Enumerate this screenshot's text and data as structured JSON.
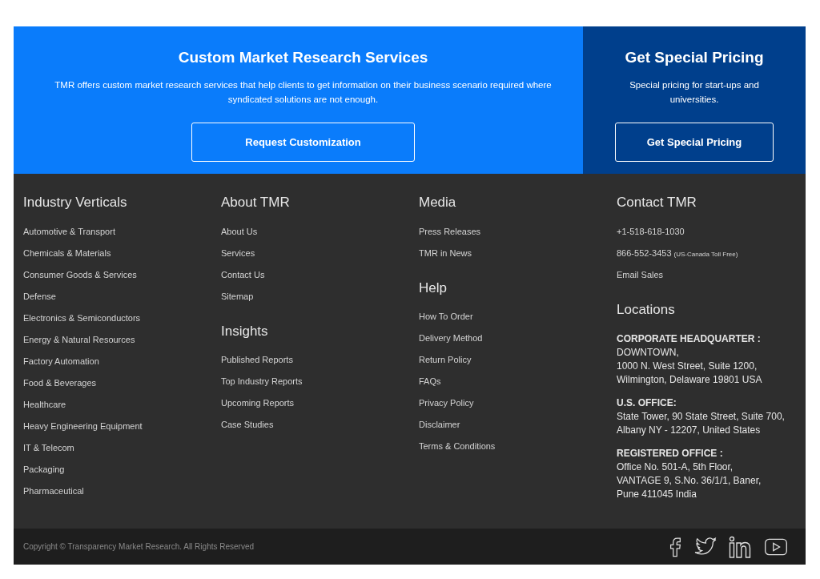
{
  "cta": [
    {
      "kind": "primary",
      "title": "Custom Market Research Services",
      "text": "TMR offers custom market research services that help clients to get information on their business scenario required where syndicated solutions are not enough.",
      "button": "Request Customization"
    },
    {
      "kind": "secondary",
      "title": "Get Special Pricing",
      "text": "Special pricing for start-ups and universities.",
      "button": "Get Special Pricing"
    }
  ],
  "columns": [
    {
      "kind": "links",
      "sections": [
        {
          "heading": "Industry Verticals",
          "links": [
            "Automotive & Transport",
            "Chemicals & Materials",
            "Consumer Goods & Services",
            "Defense",
            "Electronics & Semiconductors",
            "Energy & Natural Resources",
            "Factory Automation",
            "Food & Beverages",
            "Healthcare",
            "Heavy Engineering Equipment",
            "IT & Telecom",
            "Packaging",
            "Pharmaceutical"
          ]
        }
      ]
    },
    {
      "kind": "links",
      "sections": [
        {
          "heading": "About TMR",
          "links": [
            "About Us",
            "Services",
            "Contact Us",
            "Sitemap"
          ]
        },
        {
          "heading": "Insights",
          "links": [
            "Published Reports",
            "Top Industry Reports",
            "Upcoming Reports",
            "Case Studies"
          ]
        }
      ]
    },
    {
      "kind": "links",
      "sections": [
        {
          "heading": "Media",
          "links": [
            "Press Releases",
            "TMR in News"
          ]
        },
        {
          "heading": "Help",
          "links": [
            "How To Order",
            "Delivery Method",
            "Return Policy",
            "FAQs",
            "Privacy Policy",
            "Disclaimer",
            "Terms & Conditions"
          ]
        }
      ]
    },
    {
      "kind": "contact",
      "heading": "Contact TMR",
      "contacts": [
        {
          "text": "+1-518-618-1030"
        },
        {
          "text": "866-552-3453",
          "note": "(US-Canada Toll Free)"
        },
        {
          "text": "Email Sales"
        }
      ],
      "locations_heading": "Locations",
      "offices": [
        {
          "title": "CORPORATE HEADQUARTER :",
          "lines": [
            "DOWNTOWN,",
            "1000 N. West Street, Suite 1200,",
            "Wilmington, Delaware 19801 USA"
          ]
        },
        {
          "title": "U.S. OFFICE:",
          "lines": [
            "State Tower, 90 State Street, Suite 700,",
            "Albany NY - 12207, United States"
          ]
        },
        {
          "title": "REGISTERED OFFICE :",
          "lines": [
            "Office No. 501-A, 5th Floor,",
            "VANTAGE 9, S.No. 36/1/1, Baner,",
            "Pune 411045 India"
          ]
        }
      ]
    }
  ],
  "copyright": "Copyright © Transparency Market Research. All Rights Reserved",
  "social": [
    {
      "kind": "facebook"
    },
    {
      "kind": "twitter"
    },
    {
      "kind": "linkedin"
    },
    {
      "kind": "youtube"
    }
  ]
}
